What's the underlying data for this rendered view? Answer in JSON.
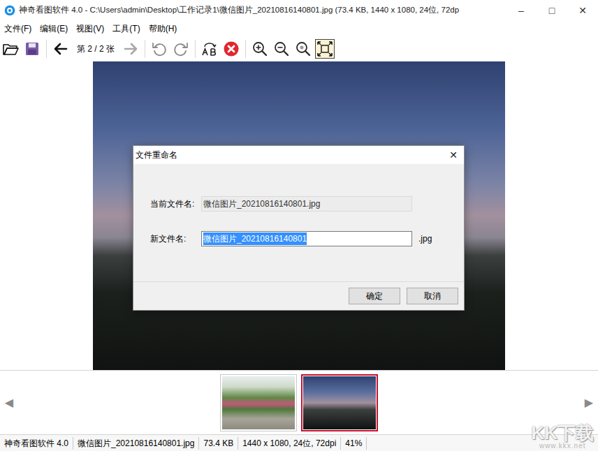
{
  "window": {
    "title": "神奇看图软件 4.0 - C:\\Users\\admin\\Desktop\\工作记录1\\微信图片_20210816140801.jpg (73.4 KB, 1440 x 1080, 24位, 72dp",
    "controls": [
      "–",
      "□",
      "✕"
    ]
  },
  "menu": [
    "文件(F)",
    "编辑(E)",
    "视图(V)",
    "工具(T)",
    "帮助(H)"
  ],
  "toolbar": [
    {
      "kind": "open",
      "disabled": false,
      "selected": false
    },
    {
      "kind": "save",
      "disabled": false,
      "selected": false
    },
    {
      "kind": "prev",
      "disabled": false,
      "selected": false
    },
    {
      "kind": "counter",
      "label": "第 2 / 2 张",
      "disabled": false,
      "selected": false
    },
    {
      "kind": "next",
      "disabled": true,
      "selected": false
    },
    {
      "kind": "rotate-left",
      "disabled": false,
      "selected": false
    },
    {
      "kind": "rotate-right",
      "disabled": false,
      "selected": false
    },
    {
      "kind": "rename",
      "disabled": false,
      "selected": false
    },
    {
      "kind": "delete",
      "disabled": false,
      "selected": false
    },
    {
      "kind": "zoom-in",
      "disabled": false,
      "selected": false
    },
    {
      "kind": "zoom-out",
      "disabled": false,
      "selected": false
    },
    {
      "kind": "zoom-actual",
      "disabled": false,
      "selected": false
    },
    {
      "kind": "fit-screen",
      "disabled": false,
      "selected": true
    }
  ],
  "dialog": {
    "title": "文件重命名",
    "close": "✕",
    "current_label": "当前文件名:",
    "current_value": "微信图片_20210816140801.jpg",
    "new_label": "新文件名:",
    "new_value": "微信图片_20210816140801",
    "new_selected": true,
    "extension": ".jpg",
    "buttons": [
      "确定",
      "取消"
    ]
  },
  "thumbnails": {
    "prev": "◀",
    "next": "▶",
    "items": [
      {
        "selected": false
      },
      {
        "selected": true
      }
    ]
  },
  "status_bar": [
    "神奇看图软件 4.0",
    "微信图片_20210816140801.jpg",
    "73.4 KB",
    "1440 x 1080, 24位, 72dpi",
    "41%"
  ],
  "watermark": {
    "logo": "KK下载",
    "url": "www.kkx.net"
  }
}
